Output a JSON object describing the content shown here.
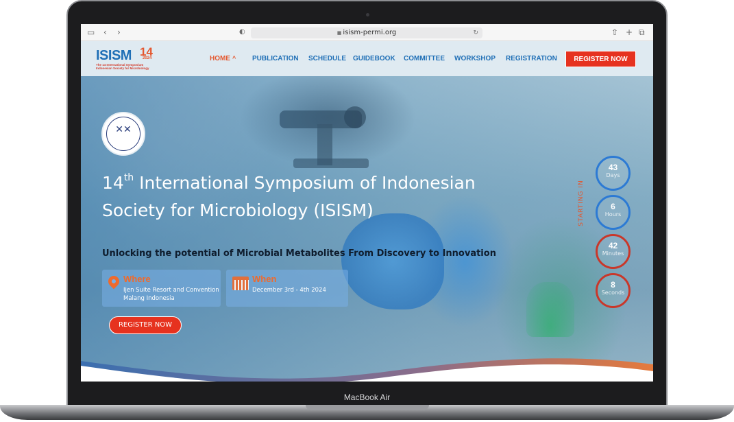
{
  "device": {
    "label": "MacBook Air"
  },
  "browser": {
    "url": "isism-permi.org",
    "icons": [
      "sidebar-icon",
      "back-icon",
      "forward-icon",
      "privacy-shield-icon",
      "lock-icon",
      "reload-icon",
      "share-icon",
      "new-tab-icon",
      "tabs-overview-icon"
    ]
  },
  "site": {
    "logo": {
      "main": "ISISM",
      "number": "14",
      "year": "2024",
      "subtitle": "The 14 International Symposium Indonesian Society for Microbiology"
    },
    "nav": {
      "items": [
        {
          "label": "HOME",
          "active": true
        },
        {
          "label": "PUBLICATION"
        },
        {
          "label": "SCHEDULE"
        },
        {
          "label": "GUIDEBOOK"
        },
        {
          "label": "COMMITTEE"
        },
        {
          "label": "WORKSHOP"
        },
        {
          "label": "REGISTRATION"
        }
      ],
      "cta": "REGISTER NOW"
    },
    "hero": {
      "title_num": "14",
      "title_sup": "th",
      "title_rest": " International Symposium of Indonesian Society for Microbiology (ISISM)",
      "subtitle": "Unlocking the potential of Microbial Metabolites From Discovery to Innovation",
      "where": {
        "title": "Where",
        "line1": "Ijen Suite Resort and Convention",
        "line2": "Malang Indonesia"
      },
      "when": {
        "title": "When",
        "line1": "December 3rd - 4th 2024"
      },
      "cta": "REGISTER NOW",
      "countdown": {
        "label": "STARTING IN",
        "items": [
          {
            "value": "43",
            "unit": "Days"
          },
          {
            "value": "6",
            "unit": "Hours"
          },
          {
            "value": "42",
            "unit": "Minutes"
          },
          {
            "value": "8",
            "unit": "Seconds"
          }
        ]
      }
    }
  },
  "colors": {
    "brand_blue": "#1f6fb6",
    "accent_orange": "#e4572e",
    "cta_red": "#e6321f"
  }
}
